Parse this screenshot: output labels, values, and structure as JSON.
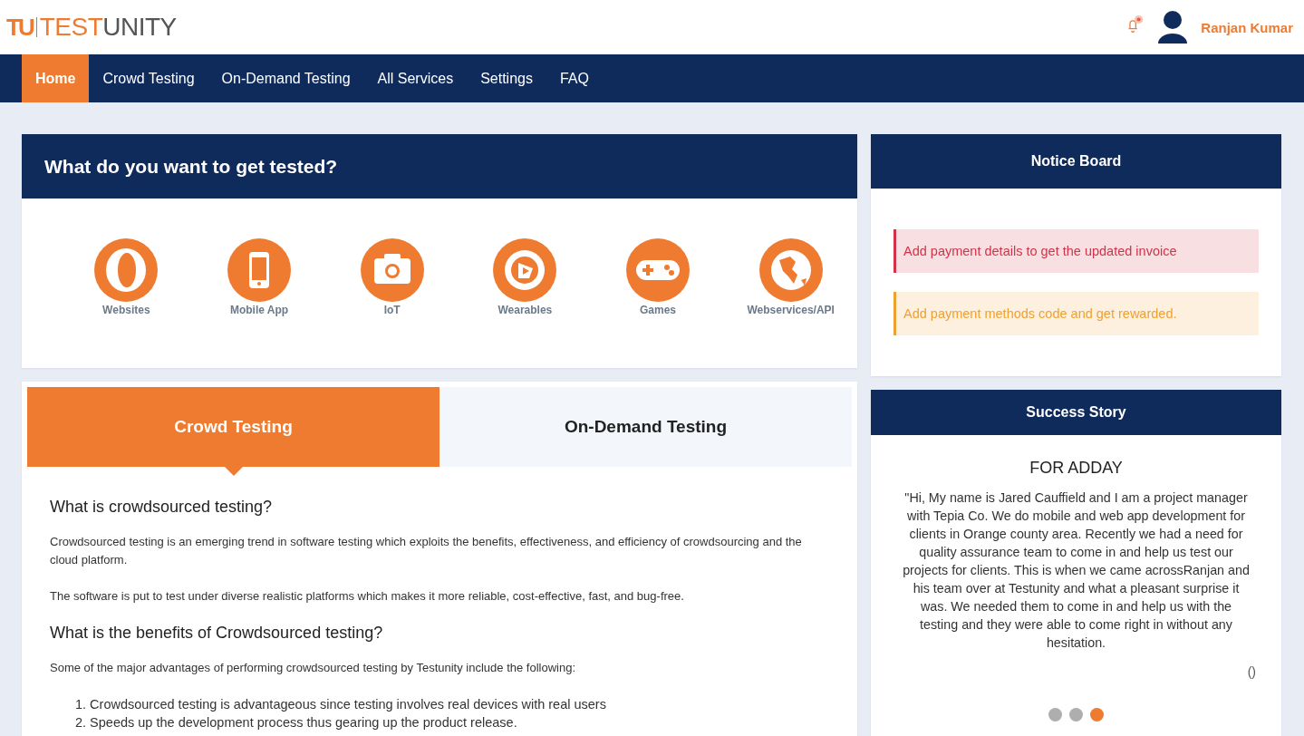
{
  "logo": {
    "mark": "TU",
    "part_1": "TEST",
    "part_2": "UNITY"
  },
  "header": {
    "notification_unread": true,
    "user_name": "Ranjan Kumar"
  },
  "nav": [
    {
      "label": "Home",
      "selected": true
    },
    {
      "label": "Crowd Testing",
      "selected": false
    },
    {
      "label": "On-Demand Testing",
      "selected": false
    },
    {
      "label": "All Services",
      "selected": false
    },
    {
      "label": "Settings",
      "selected": false
    },
    {
      "label": "FAQ",
      "selected": false
    }
  ],
  "test_panel": {
    "title": "What do you want to get tested?",
    "items": [
      {
        "kind": "websites",
        "label": "Websites"
      },
      {
        "kind": "mobile",
        "label": "Mobile App"
      },
      {
        "kind": "iot",
        "label": "IoT"
      },
      {
        "kind": "wearables",
        "label": "Wearables"
      },
      {
        "kind": "games",
        "label": "Games"
      },
      {
        "kind": "api",
        "label": "Webservices/API"
      }
    ]
  },
  "tabs": [
    {
      "label": "Crowd Testing",
      "selected": true
    },
    {
      "label": "On-Demand Testing",
      "selected": false
    }
  ],
  "content": [
    {
      "kind": "heading",
      "text": "What is crowdsourced testing?"
    },
    {
      "kind": "paragraph",
      "text": "Crowdsourced testing is an emerging trend in software testing which exploits the benefits, effectiveness, and efficiency of crowdsourcing and the cloud platform."
    },
    {
      "kind": "paragraph",
      "text": "The software is put to test under diverse realistic platforms which makes it more reliable, cost-effective, fast, and bug-free."
    },
    {
      "kind": "heading",
      "text": "What is the benefits of Crowdsourced testing?"
    },
    {
      "kind": "paragraph",
      "text": "Some of the major advantages of performing crowdsourced testing by Testunity include the following:"
    },
    {
      "kind": "list",
      "items": [
        {
          "number": "1.",
          "text": "Crowdsourced testing is advantageous since testing involves real devices with real users"
        },
        {
          "number": "2.",
          "text": "Speeds up the development process thus gearing up the product release."
        }
      ]
    }
  ],
  "notice_board": {
    "title": "Notice Board",
    "notices": [
      {
        "kind": "danger",
        "text": "Add payment details to get the updated invoice"
      },
      {
        "kind": "warning",
        "text": "Add payment methods code and get rewarded."
      }
    ]
  },
  "success_story": {
    "title": "Success Story",
    "company": "FOR ADDAY",
    "quote": "\"Hi, My name is Jared Cauffield and I am a project manager with Tepia Co. We do mobile and web app development for clients in Orange county area. Recently we had a need for quality assurance team to come in and help us test our projects for clients. This is when we came acrossRanjan and his team over at Testunity and what a pleasant surprise it was. We needed them to come in and help us with the testing and they were able to come right in without any hesitation.",
    "author": "()",
    "dots": [
      {
        "selected": false
      },
      {
        "selected": false
      },
      {
        "selected": true
      }
    ]
  }
}
